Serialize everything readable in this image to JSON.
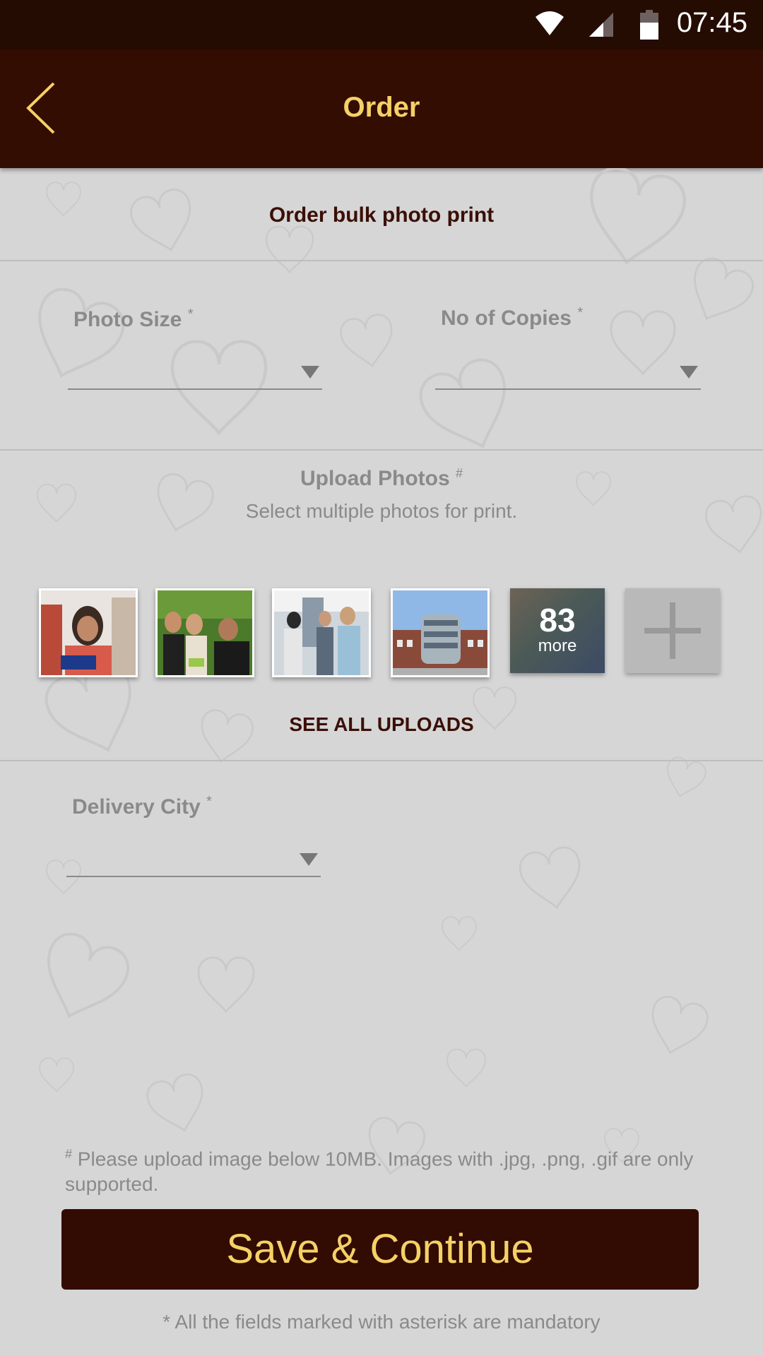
{
  "status_bar": {
    "time": "07:45",
    "icons": [
      "wifi-icon",
      "signal-icon",
      "battery-icon"
    ]
  },
  "app_bar": {
    "title": "Order",
    "back_icon": "chevron-left-icon"
  },
  "main": {
    "section_title": "Order bulk photo print",
    "photo_size": {
      "label": "Photo Size",
      "required_mark": "*",
      "value": ""
    },
    "copies": {
      "label": "No of Copies",
      "required_mark": "*",
      "value": ""
    },
    "upload": {
      "title": "Upload Photos",
      "title_mark": "#",
      "subtitle": "Select multiple photos for print.",
      "thumbnails": [
        "student-photo",
        "group-photo",
        "friends-photo",
        "building-photo"
      ],
      "more_count": "83",
      "more_label": "more",
      "see_all": "SEE ALL UPLOADS"
    },
    "delivery_city": {
      "label": "Delivery City",
      "required_mark": "*",
      "value": ""
    },
    "note_mark": "#",
    "note_text": "Please upload image below 10MB. Images with .jpg, .png, .gif are only supported.",
    "save_button": "Save & Continue",
    "footnote": "* All the fields marked with asterisk are mandatory"
  },
  "colors": {
    "header_bg": "#330d02",
    "status_bg": "#250c03",
    "accent_yellow": "#f5d166",
    "page_bg": "#d6d6d6",
    "muted_text": "#8a8a8a",
    "dark_text": "#3a0f05"
  }
}
